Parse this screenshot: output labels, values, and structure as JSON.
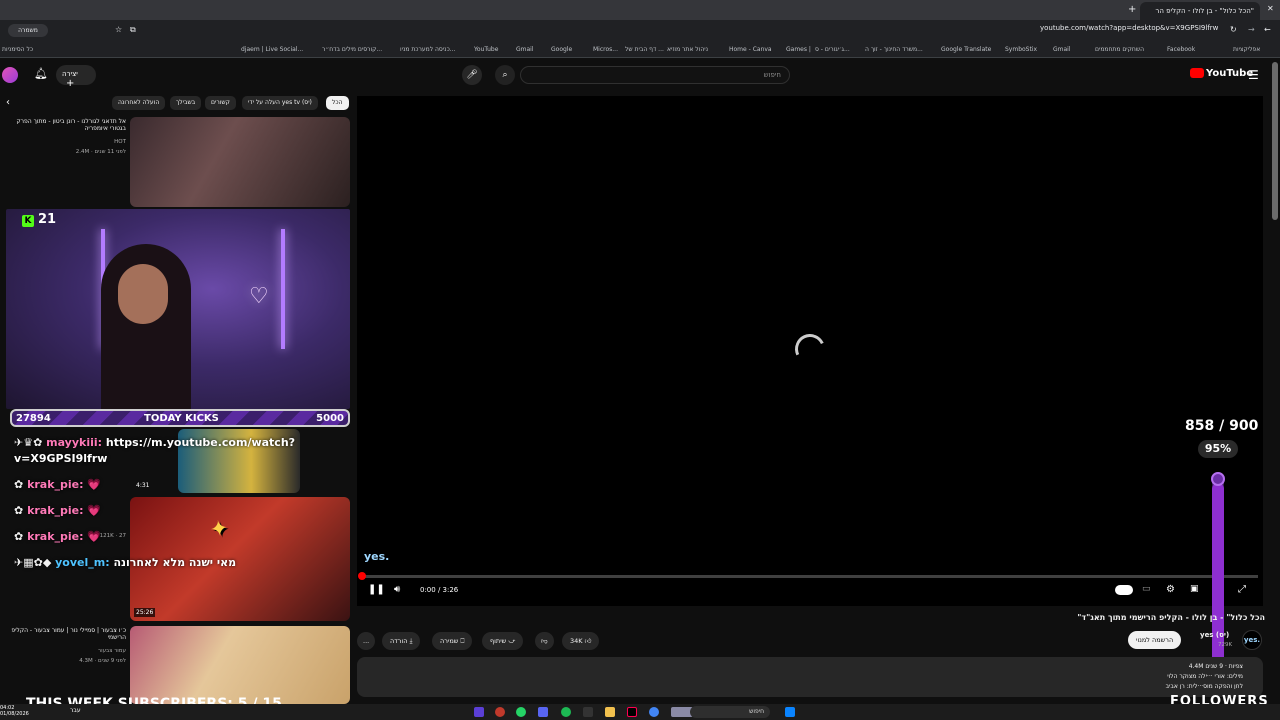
{
  "browser": {
    "tab_title": "\"הכל כלול\" - בן לולו - הקליפ הר",
    "new_tab": "+",
    "url": "youtube.com/watch?app=desktop&v=X9GPSI9lfrw",
    "left_tab": "משמרה",
    "bookmarks": [
      {
        "label": "אפליקציות"
      },
      {
        "label": "Facebook"
      },
      {
        "label": "השחקים מתחממים"
      },
      {
        "label": "Gmail"
      },
      {
        "label": "SymboStix"
      },
      {
        "label": "Google Translate"
      },
      {
        "label": "משרד החינוך - זוך ה..."
      },
      {
        "label": "ג׳יגורים - ס..."
      },
      {
        "label": "Games |"
      },
      {
        "label": "Home - Canva"
      },
      {
        "label": "ניהול אתר מוזיא"
      },
      {
        "label": "דף הבית של ..."
      },
      {
        "label": "Micros..."
      },
      {
        "label": "Google"
      },
      {
        "label": "Gmail"
      },
      {
        "label": "YouTube"
      },
      {
        "label": "כניסה למערכת מניו..."
      },
      {
        "label": "קורסים מילים בדח״ר..."
      },
      {
        "label": "djaem | Live Social..."
      },
      {
        "label": "כל הסימניות"
      }
    ]
  },
  "youtube": {
    "logo": "YouTube",
    "search_placeholder": "חיפוש",
    "create_label": "יצירה",
    "chips": [
      "הכל",
      "העלה על ידי yes tv (יס)",
      "קשורים",
      "בשבילך",
      "הועלה לאחרונה"
    ],
    "player": {
      "time": "0:00 / 3:26",
      "caption": "yes."
    },
    "video": {
      "title": "\"הכל כלול\" - בן לולו - הקליפ הרישמי מתוך תאג\"ד",
      "channel": "yes (יס)",
      "channel_subs": "729K",
      "subscribe_label": "הרשמה למנוי",
      "likes": "34K",
      "share_label": "שיתוף",
      "save_label": "שמירה",
      "download_label": "הורדה",
      "more_label": "...",
      "desc_line1": "4.4M צפיות · 9 שנים",
      "desc_line2": "מילים: אורי ···ילה מצוקר הלוי",
      "desc_line3": "לחן והפקה מוס···לית: רן אביב"
    },
    "recommendations": [
      {
        "title": "אל תדאגי לגורלנו - רונן ביטון - מתוך הפרק בגטורי איומפריה",
        "channel": "HOT",
        "meta": "2.4M · לפני 11 שנים"
      },
      {
        "title": "מאי ישנה מלא לאחרונה",
        "duration": "25:26",
        "meta": "121K · 27"
      },
      {
        "title": "כ׳ו צבעור | סמיילי נור | עמור צבעור - הקליפ הרישמי",
        "channel": "עמור צבעור",
        "meta": "4.3M · לפני 9 שנים"
      }
    ],
    "small_duration": "4:31"
  },
  "stream_overlay": {
    "kick_count": "21",
    "kicks_left": "27894",
    "kicks_label": "TODAY KICKS",
    "kicks_right": "5000",
    "chat": [
      {
        "user": "mayykiii:",
        "msg": "https://m.youtube.com/watch?",
        "msg2": "v=X9GPSI9lfrw"
      },
      {
        "user": "krak_pie:",
        "msg": "💗"
      },
      {
        "user": "krak_pie:",
        "msg": "💗"
      },
      {
        "user": "krak_pie:",
        "msg": "💗"
      },
      {
        "user": "yovel_m:",
        "msg": "מאי ישנה מלא לאחרונה"
      }
    ],
    "goal_count": "858 / 900",
    "goal_pct": "95%",
    "goal_fraction": 0.95,
    "followers_label": "FOLLOWERS",
    "subs_goal": "THIS WEEK SUBSCRIBERS: 5 / 15"
  },
  "taskbar": {
    "time": "04:02",
    "date": "01/08/2026",
    "search_label": "חיפוש",
    "lang": "עבר"
  },
  "colors": {
    "accent_red": "#ff0000",
    "kick_green": "#53fc18",
    "goal_purple": "#8e2fd1",
    "chat_pink": "#ff7ab8",
    "chat_blue": "#4fc3ff"
  }
}
